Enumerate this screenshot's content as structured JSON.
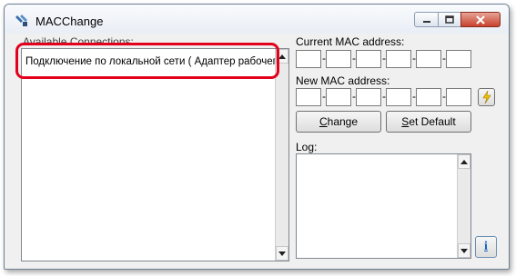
{
  "window": {
    "title": "MACChange",
    "icon": "app-gear-icon"
  },
  "titlebar_buttons": {
    "minimize_icon": "minimize-icon",
    "maximize_icon": "maximize-icon",
    "close_icon": "close-icon"
  },
  "connections": {
    "label": "Available Connections:",
    "items": [
      "Подключение по локальной сети ( Адаптер рабочего"
    ]
  },
  "current_mac": {
    "label": "Current MAC address:",
    "octets": [
      "",
      "",
      "",
      "",
      "",
      ""
    ]
  },
  "new_mac": {
    "label": "New MAC address:",
    "octets": [
      "",
      "",
      "",
      "",
      "",
      ""
    ],
    "random_icon": "lightning-icon"
  },
  "buttons": {
    "change_first": "C",
    "change_rest": "hange",
    "set_default_first": "S",
    "set_default_rest": "et Default",
    "info_label": "i"
  },
  "log": {
    "label": "Log:",
    "content": ""
  },
  "colors": {
    "highlight": "#e3001b",
    "close_button": "#c7422c",
    "info_accent": "#1565c0"
  }
}
